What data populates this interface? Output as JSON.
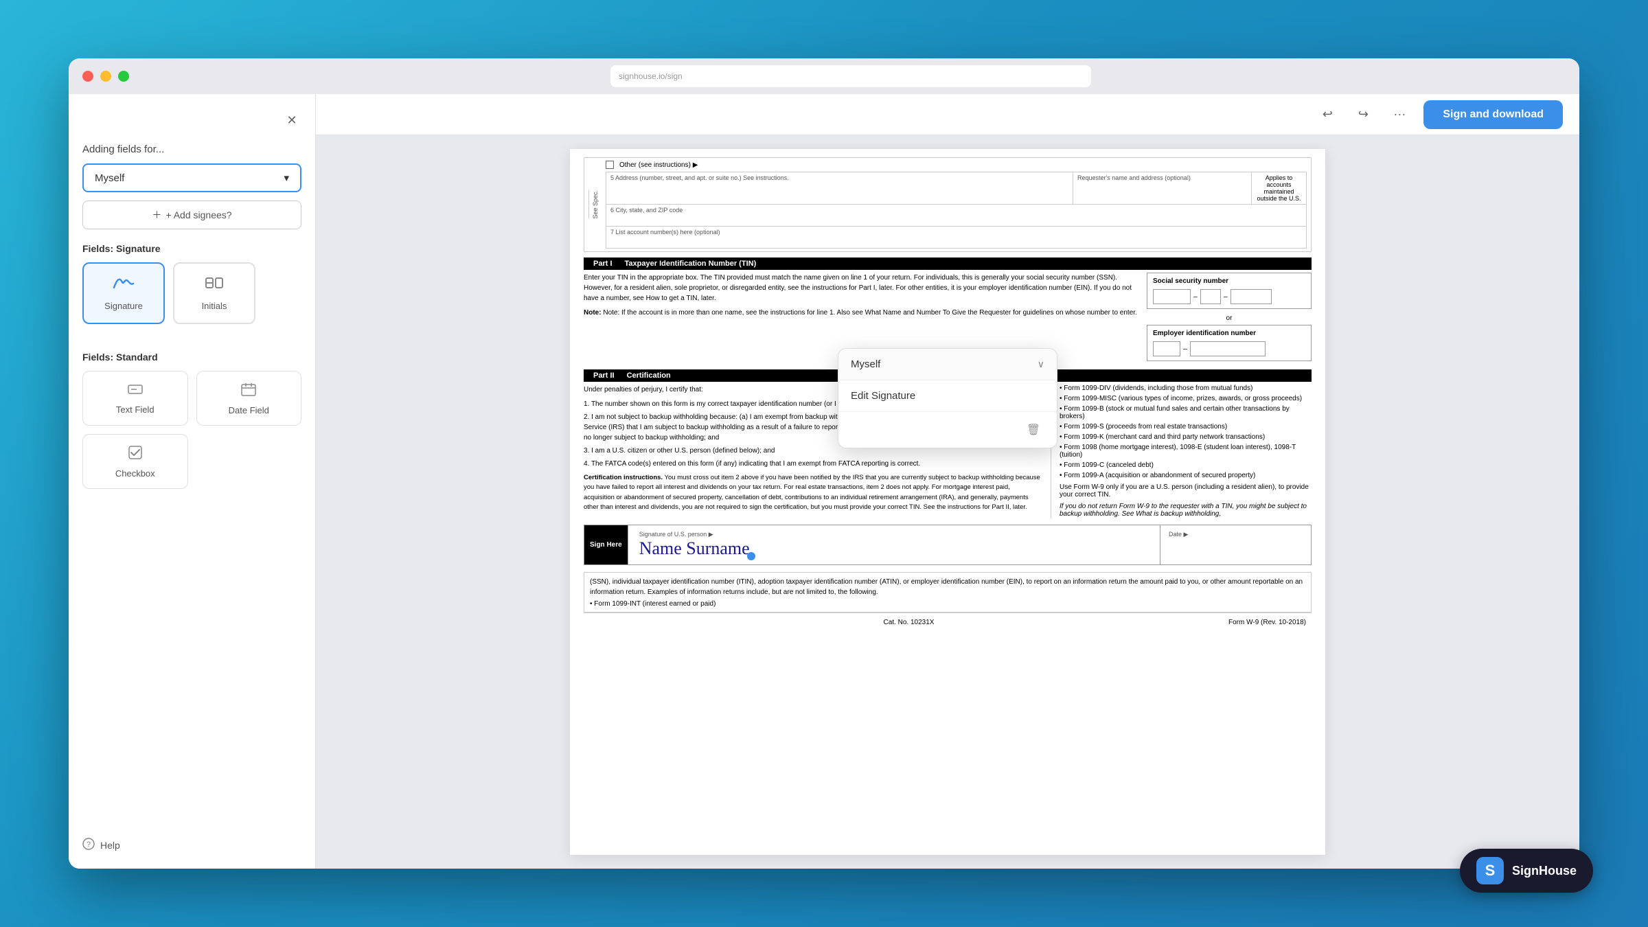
{
  "browser": {
    "url": "",
    "traffic_lights": {
      "close": "close",
      "minimize": "minimize",
      "maximize": "maximize"
    }
  },
  "toolbar": {
    "undo_label": "←",
    "redo_label": "→",
    "more_label": "···",
    "sign_download_label": "Sign and download"
  },
  "sidebar": {
    "close_label": "✕",
    "adding_fields_label": "Adding fields for...",
    "signee": "Myself",
    "add_signees_label": "+ Add signees?",
    "signature_section_label": "Fields: Signature",
    "signature_btn_label": "Signature",
    "initials_btn_label": "Initials",
    "standard_section_label": "Fields: Standard",
    "text_field_label": "Text Field",
    "date_field_label": "Date Field",
    "checkbox_label": "Checkbox",
    "help_label": "Help"
  },
  "dropdown_popup": {
    "signee": "Myself",
    "chevron": "∨",
    "edit_signature_label": "Edit Signature",
    "delete_label": "🗑"
  },
  "document": {
    "title": "Form W-9",
    "sign_here_label": "Sign Here",
    "sign_here_sub": "Signature of U.S. person ▶",
    "date_label": "Date ▶",
    "signature_text": "Name Surname",
    "part1_label": "Part I",
    "part1_title": "Taxpayer Identification Number (TIN)",
    "part2_label": "Part II",
    "part2_title": "Certification",
    "ssn_label": "Social security number",
    "ein_label": "Employer identification number",
    "catalog_no": "Cat. No. 10231X",
    "form_name": "Form W-9 (Rev. 10-2018)",
    "address_label": "5  Address (number, street, and apt. or suite no.) See instructions.",
    "requester_label": "Requester's name and address (optional)",
    "city_label": "6  City, state, and ZIP code",
    "account_label": "7  List account number(s) here (optional)",
    "other_label": "Other (see instructions) ▶",
    "applies_text": "Applies to accounts maintained outside the U.S.",
    "tin_text": "Enter your TIN in the appropriate box. The TIN provided must match the name given on line 1 of your return. For individuals, this is generally your social security number (SSN). However, for a resident alien, sole proprietor, or disregarded entity, see the instructions for Part I, later. For other entities, it is your employer identification number (EIN). If you do not have a number, see How to get a TIN, later.",
    "note_text": "Note: If the account is in more than one name, see the instructions for line 1. Also see What Name and Number To Give the Requester for guidelines on whose number to enter.",
    "cert_intro": "Under penalties of perjury, I certify that:",
    "cert_items": [
      "1. The number shown on this form is my correct taxpayer identification number (or I am waiting for a number to be issued to me); and",
      "2. I am not subject to backup withholding because: (a) I am exempt from backup withholding, or (b) I have not been notified by the Internal Revenue Service (IRS) that I am subject to backup withholding as a result of a failure to report all interest or dividends, or (c) the IRS has notified me that I am no longer subject to backup withholding; and",
      "3. I am a U.S. citizen or other U.S. person (defined below); and",
      "4. The FATCA code(s) entered on this form (if any) indicating that I am exempt from FATCA reporting is correct."
    ],
    "cert_instructions_label": "Certification instructions.",
    "cert_instructions_text": "You must cross out item 2 above if you have been notified by the IRS that you are currently subject to backup withholding because you have failed to report all interest and dividends on your tax return. For real estate transactions, item 2 does not apply. For mortgage interest paid, acquisition or abandonment of secured property, cancellation of debt, contributions to an individual retirement arrangement (IRA), and generally, payments other than interest and dividends, you are not required to sign the certification, but you must provide your correct TIN. See the instructions for Part II, later.",
    "right_col_items": [
      "• Form 1099-DIV (dividends, including those from mutual funds)",
      "• Form 1099-MISC (various types of income, prizes, awards, or gross proceeds)",
      "• Form 1099-B (stock or mutual fund sales and certain other transactions by brokers)",
      "• Form 1099-S (proceeds from real estate transactions)",
      "• Form 1099-K (merchant card and third party network transactions)",
      "• Form 1098 (home mortgage interest), 1098-E (student loan interest), 1098-T (tuition)",
      "• Form 1099-C (canceled debt)",
      "• Form 1099-A (acquisition or abandonment of secured property)",
      "Use Form W-9 only if you are a U.S. person (including a resident alien), to provide your correct TIN.",
      "If you do not return Form W-9 to the requester with a TIN, you might be subject to backup withholding. See What is backup withholding,"
    ]
  },
  "signhouse": {
    "badge_letter": "S",
    "badge_name": "SignHouse"
  }
}
